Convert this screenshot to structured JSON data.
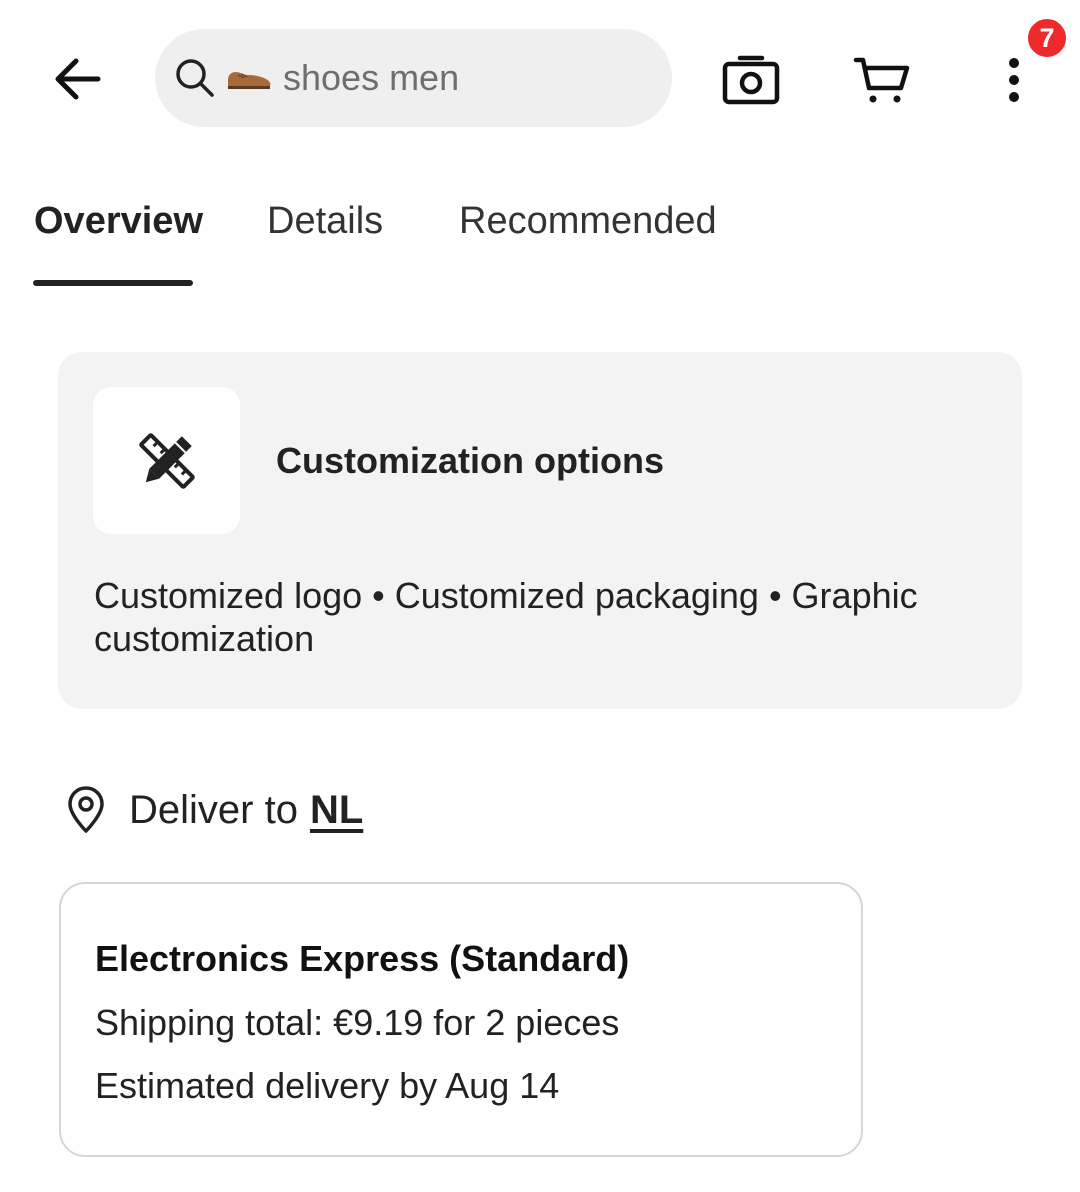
{
  "header": {
    "back_icon": "arrow-left-icon",
    "search": {
      "query": "shoes men",
      "search_icon": "search-icon",
      "thumbnail_icon": "brown-shoe-icon"
    },
    "camera_icon": "camera-icon",
    "cart_icon": "cart-icon",
    "more_icon": "vertical-dots-icon",
    "badge_count": "7",
    "badge_color": "#ee2a2a"
  },
  "tabs": [
    {
      "label": "Overview",
      "active": true
    },
    {
      "label": "Details",
      "active": false
    },
    {
      "label": "Recommended",
      "active": false
    }
  ],
  "customization": {
    "icon": "ruler-pencil-icon",
    "title": "Customization options",
    "description": "Customized logo • Customized packaging • Graphic customization"
  },
  "delivery": {
    "icon": "location-pin-icon",
    "label": "Deliver to",
    "country": "NL"
  },
  "shipping": {
    "title": "Electronics Express (Standard)",
    "total": "Shipping total: €9.19 for 2 pieces",
    "eta": "Estimated delivery by Aug 14"
  }
}
